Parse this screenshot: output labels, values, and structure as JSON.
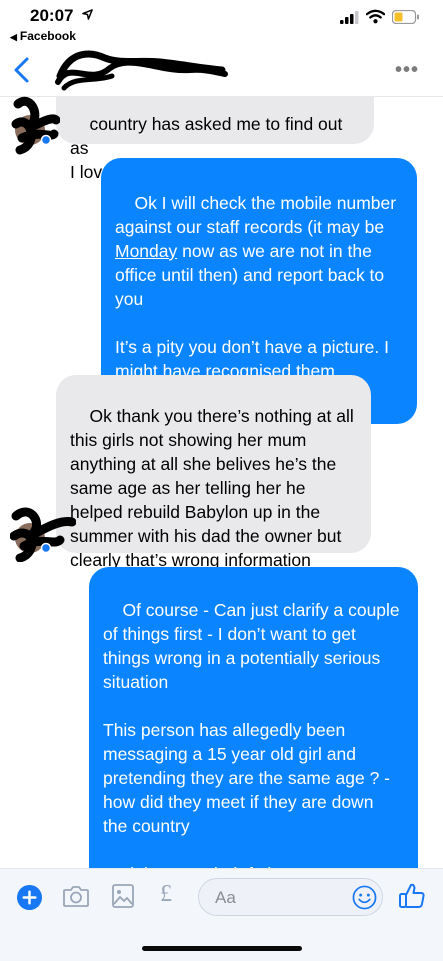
{
  "status_bar": {
    "time": "20:07",
    "back_app": "Facebook"
  },
  "header": {
    "contact_name": "",
    "more_label": "•••"
  },
  "messages": [
    {
      "direction": "incoming",
      "text": "country has asked me to find out as\nI love in Newcastle x"
    },
    {
      "direction": "outgoing",
      "text_before": "Ok I will check the mobile number\nagainst our staff records (it may be\n",
      "link": "Monday",
      "text_after": " now as we are not in the\noffice until then) and report back to\nyou\n\nIt’s a pity you don’t have a picture. I\nmight have recognised them."
    },
    {
      "direction": "incoming",
      "text": "Ok thank you there’s nothing at all\nthis girls not showing her mum\nanything at all she belives he’s the\nsame age as her telling her he\nhelped rebuild Babylon up in the\nsummer with his dad the owner but\nclearly that’s wrong information"
    },
    {
      "direction": "outgoing",
      "text": "Of course - Can just clarify a couple\nof things first - I don’t want to get\nthings wrong in a potentially serious\nsituation\n\nThis person has allegedly been\nmessaging a 15 year old girl and\npretending they are the same age ? -\nhow did they meet if they are down\nthe country\n\nAnd they say their father owns\nBabylon"
    }
  ],
  "composer": {
    "placeholder": "Aa",
    "pound_label": "£"
  },
  "colors": {
    "outgoing_bubble": "#0a84ff",
    "incoming_bubble": "#e9e9eb",
    "accent": "#1877f2"
  }
}
